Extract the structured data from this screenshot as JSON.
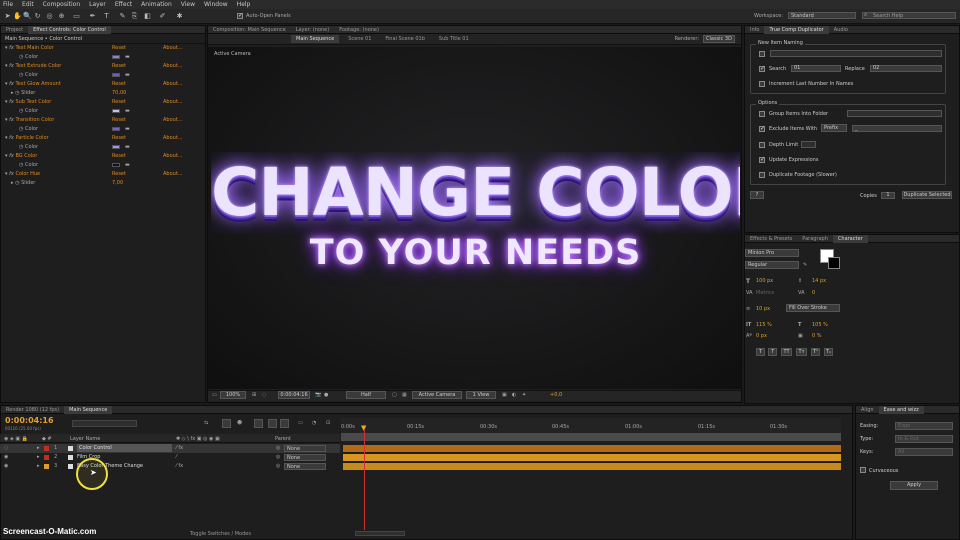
{
  "menu": [
    "File",
    "Edit",
    "Composition",
    "Layer",
    "Effect",
    "Animation",
    "View",
    "Window",
    "Help"
  ],
  "toolbar": {
    "auto_open_panels": "Auto-Open Panels",
    "workspace_label": "Workspace:",
    "workspace_value": "Standard",
    "search_help": "Search Help"
  },
  "left_panel": {
    "tabs": [
      "Project",
      "Effect Controls: Color Control"
    ],
    "breadcrumb": "Main Sequence • Color Control",
    "reset": "Reset",
    "about": "About...",
    "effects": [
      {
        "name": "Text Main Color",
        "prop": "Color"
      },
      {
        "name": "Text Extrude Color",
        "prop": "Color"
      },
      {
        "name": "Text Glow Amount",
        "prop": "Slider",
        "value": "70,00"
      },
      {
        "name": "Sub Text Color",
        "prop": "Color"
      },
      {
        "name": "Transition Color",
        "prop": "Color"
      },
      {
        "name": "Particle Color",
        "prop": "Color"
      },
      {
        "name": "BG Color",
        "prop": "Color"
      },
      {
        "name": "Color Hue",
        "prop": "Slider",
        "value": "7,00"
      }
    ]
  },
  "comp": {
    "tabs": [
      "Composition: Main Sequence",
      "Layer: (none)",
      "Footage: (none)"
    ],
    "subtabs": [
      "Main Sequence",
      "Scene 01",
      "Final Scene 01b",
      "Sub Title 01"
    ],
    "renderer": "Renderer:",
    "renderer_value": "Classic 3D",
    "active_camera": "Active Camera",
    "headline": "CHANGE COLOR",
    "subline": "TO YOUR NEEDS",
    "footer": {
      "zoom": "100%",
      "time": "0:00:04:16",
      "res": "Half",
      "camera": "Active Camera",
      "view": "1 View",
      "offset": "+0,0"
    }
  },
  "right_panel": {
    "tabs": [
      "Info",
      "True Comp Duplicator",
      "Audio"
    ],
    "new_item_naming": "New Item Naming",
    "search_label": "Search",
    "search_value": "01",
    "replace_label": "Replace",
    "replace_value": "02",
    "increment": "Increment Last Number In Names",
    "options": "Options",
    "group_items": "Group Items Into Folder",
    "exclude_items": "Exclude Items With",
    "exclude_mode": "Prefix",
    "exclude_value": "_",
    "depth_limit": "Depth Limit",
    "update_expr": "Update Expressions",
    "duplicate_footage": "Duplicate Footage (Slower)",
    "help": "?",
    "copies_label": "Copies",
    "copies_value": "1",
    "dup_btn": "Duplicate Selected"
  },
  "char_panel": {
    "tabs": [
      "Effects & Presets",
      "Paragraph",
      "Character"
    ],
    "font": "Minion Pro",
    "style": "Regular",
    "size": "100 px",
    "leading": "14 px",
    "tracking_label": "Metrics",
    "tracking": "0",
    "stroke": "10 px",
    "stroke_mode": "Fill Over Stroke",
    "vscale": "115 %",
    "hscale": "105 %",
    "baseline": "0 px",
    "tsume": "0 %",
    "styles": [
      "T",
      "T",
      "TT",
      "Tт",
      "T¹",
      "T₁"
    ]
  },
  "timeline": {
    "tabs": [
      "Render 1080 (12 fps)",
      "Main Sequence"
    ],
    "timecode": "0:00:04:16",
    "fps": "00116 (25.00 fps)",
    "col_layer": "Layer Name",
    "col_parent": "Parent",
    "layers": [
      {
        "num": "1",
        "name": "Color Control",
        "parent": "None"
      },
      {
        "num": "2",
        "name": "Film Crop",
        "parent": "None"
      },
      {
        "num": "3",
        "name": "Easy Color Theme Change",
        "parent": "None"
      }
    ],
    "ruler": [
      "0:00s",
      "00:15s",
      "00:30s",
      "00:45s",
      "01:00s",
      "01:15s",
      "01:30s"
    ],
    "toggle": "Toggle Switches / Modes"
  },
  "align_panel": {
    "tabs": [
      "Align",
      "Ease and wizz"
    ],
    "easing": "Easing:",
    "type": "Type:",
    "keys": "Keys:",
    "easing_val": "Expo",
    "type_val": "In & Out",
    "keys_val": "All",
    "curvaceous": "Curvaceous",
    "apply": "Apply"
  },
  "watermark": "Screencast-O-Matic.com"
}
